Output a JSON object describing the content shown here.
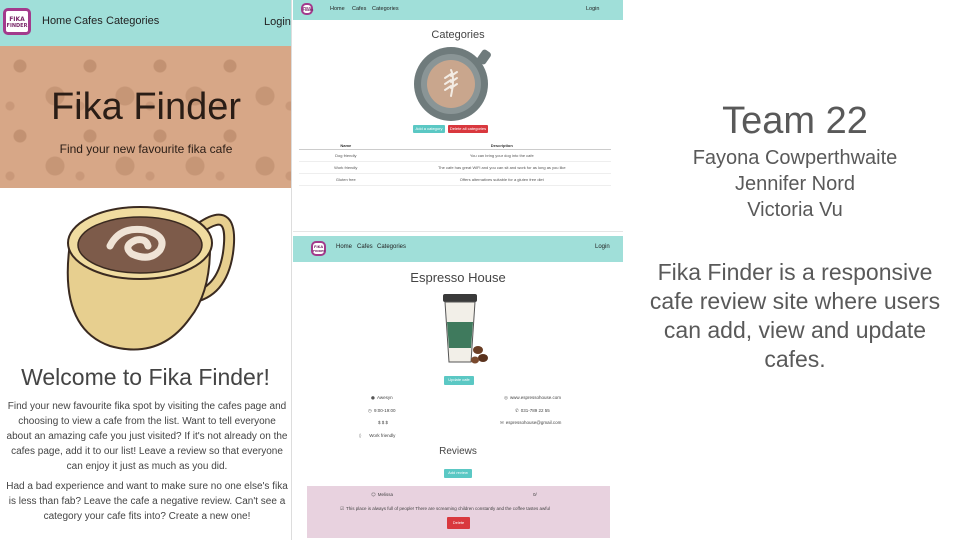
{
  "logo": {
    "line1": "FIKA",
    "line2": "FINDER"
  },
  "nav": {
    "home": "Home",
    "cafes": "Cafes",
    "categories": "Categories",
    "login": "Login"
  },
  "home": {
    "hero_title": "Fika Finder",
    "hero_subtitle": "Find your new favourite fika cafe",
    "welcome": "Welcome to Fika Finder!",
    "paragraph1": "Find your new favourite fika spot by visiting the cafes page and choosing to view a cafe from the list. Want to tell everyone about an amazing cafe you just visited? If it's not already on the cafes page, add it to our list! Leave a review so that everyone can enjoy it just as much as you did.",
    "paragraph2": "Had a bad experience and want to make sure no one else's fika is less than fab? Leave the cafe a negative review. Can't see a category your cafe fits into? Create a new one!"
  },
  "categories_page": {
    "heading": "Categories",
    "add_button": "Add a category",
    "delete_button": "Delete all categories",
    "columns": [
      "Name",
      "Description"
    ],
    "rows": [
      [
        "Dog friendly",
        "You can bring your dog into the cafe"
      ],
      [
        "Work friendly",
        "The cafe has great WiFi and you can sit and work for as long as you like"
      ],
      [
        "Gluten free",
        "Offers alternatives suitable for a gluten free diet"
      ]
    ]
  },
  "cafe_page": {
    "heading": "Espresso House",
    "update_button": "Update cafe",
    "location": "Awesyn",
    "hours": "9:00-19:00",
    "price": "$ $ $",
    "category": "Work friendly",
    "website": "www.espressohouse.com",
    "phone": "031-789 22 55",
    "email": "espressohouse@gmail.com",
    "reviews_heading": "Reviews",
    "add_review_button": "Add review",
    "review": {
      "author": "Melissa",
      "rating": "0/",
      "text": "This place is always full of people! There are screaming children constantly and the coffee tastes awful",
      "delete_button": "Delete"
    }
  },
  "team": {
    "title": "Team 22",
    "members": [
      "Fayona Cowperthwaite",
      "Jennifer Nord",
      "Victoria Vu"
    ],
    "description": "Fika Finder is a responsive cafe review site where users can add, view and update cafes."
  },
  "colors": {
    "nav_bg": "#a0dfd9",
    "accent_teal": "#5bc8c4",
    "danger": "#d9383e",
    "review_bg": "#e8d2df",
    "logo": "#a33a8c"
  }
}
